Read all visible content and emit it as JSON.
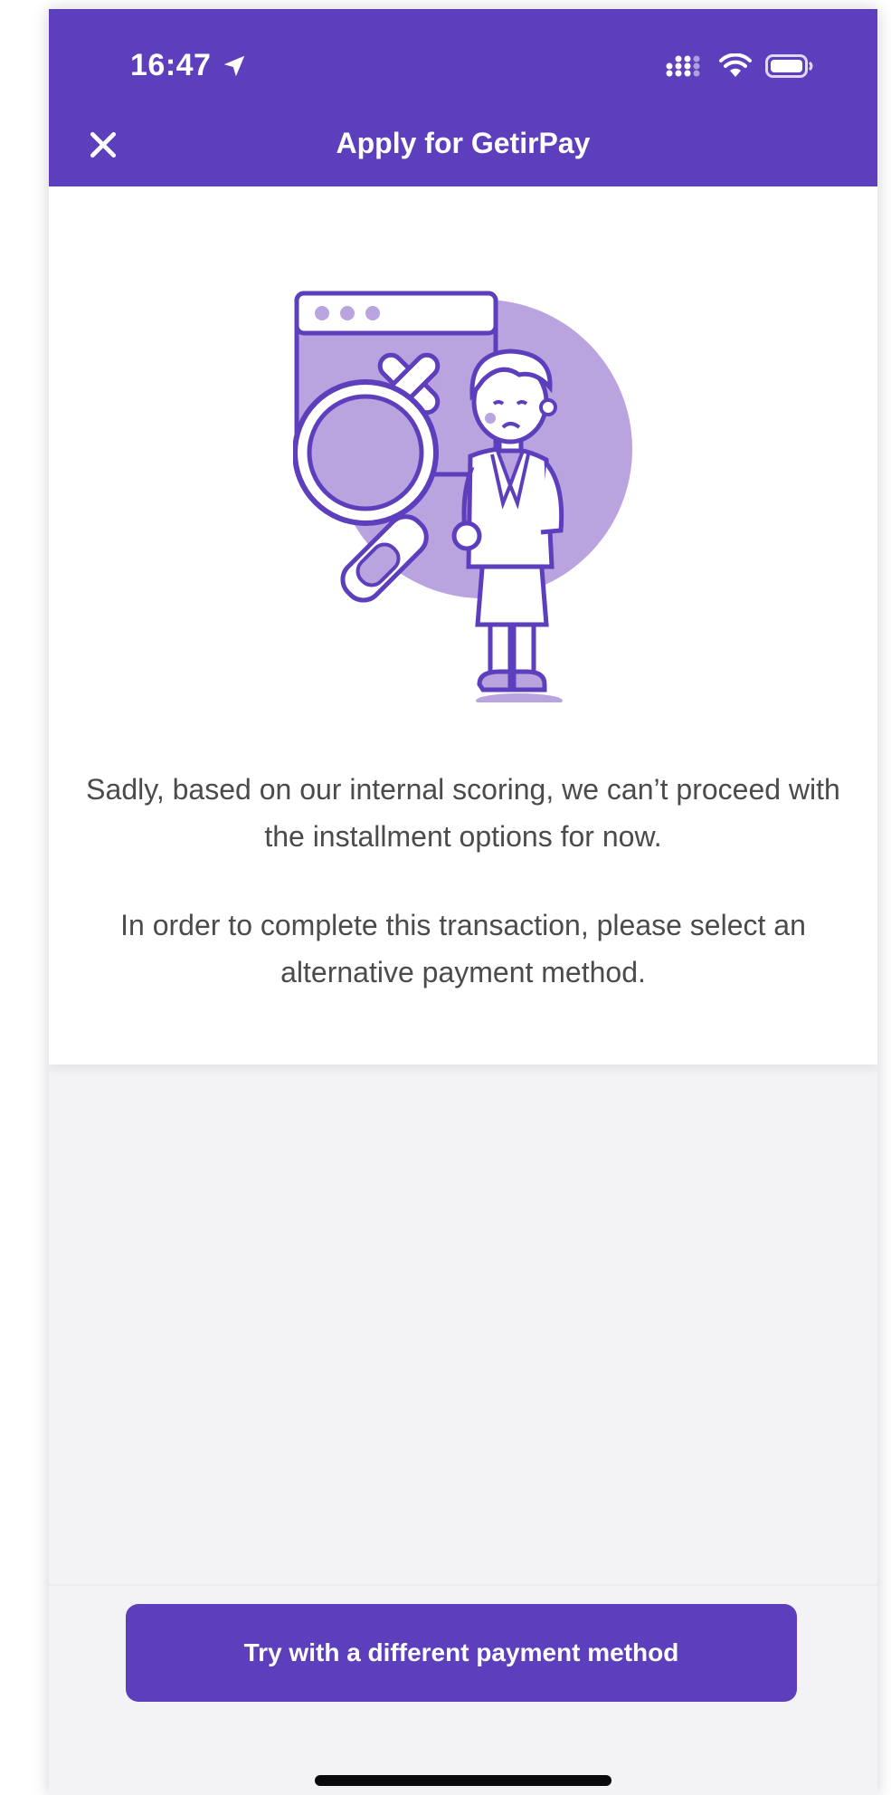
{
  "status_bar": {
    "time": "16:47",
    "location_icon": "location-arrow-icon",
    "signal_icon": "cellular-signal-icon",
    "wifi_icon": "wifi-icon",
    "battery_icon": "battery-icon"
  },
  "header": {
    "title": "Apply for GetirPay",
    "close_icon": "close-icon",
    "background_color": "#5d3ebc"
  },
  "illustration": {
    "icon": "search-rejected-illustration"
  },
  "message": {
    "line1": "Sadly, based on our internal scoring, we can’t proceed with the installment options for now.",
    "line2": "In order to complete this transaction, please select an alternative payment method."
  },
  "footer": {
    "cta_label": "Try with a different payment method",
    "cta_color": "#5d3ebc"
  }
}
